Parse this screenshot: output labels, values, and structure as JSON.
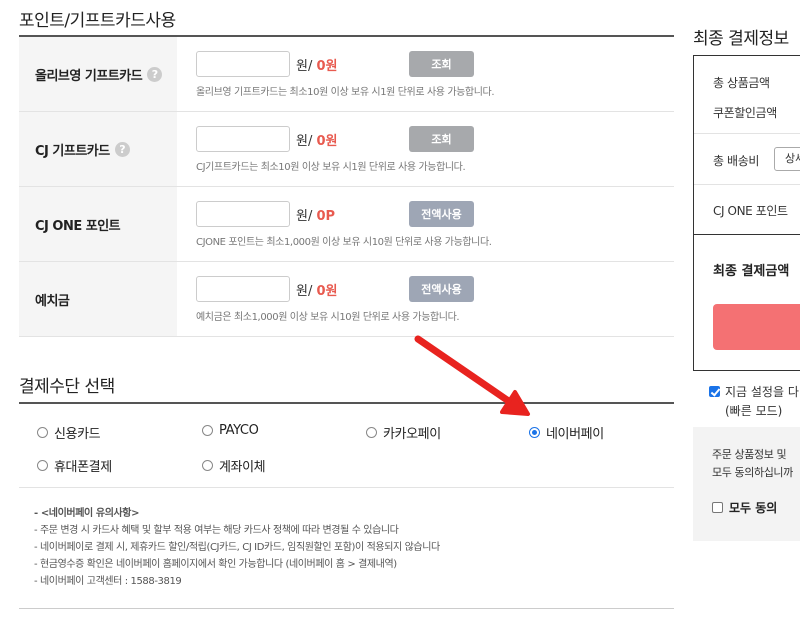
{
  "section_points": {
    "title": "포인트/기프트카드사용",
    "rows": [
      {
        "label": "올리브영 기프트카드",
        "help": "?",
        "unit": "원",
        "value": "0원",
        "button": "조회",
        "note": "올리브영 기프트카드는 최소10원 이상 보유 시1원 단위로 사용 가능합니다."
      },
      {
        "label": "CJ 기프트카드",
        "help": "?",
        "unit": "원",
        "value": "0원",
        "button": "조회",
        "note": "CJ기프트카드는 최소10원 이상 보유 시1원 단위로 사용 가능합니다."
      },
      {
        "label": "CJ ONE 포인트",
        "unit": "원",
        "value": "0P",
        "button": "전액사용",
        "note": "CJONE 포인트는 최소1,000원 이상 보유 시10원 단위로 사용 가능합니다."
      },
      {
        "label": "예치금",
        "unit": "원",
        "value": "0원",
        "button": "전액사용",
        "note": "예치금은 최소1,000원 이상 보유 시10원 단위로 사용 가능합니다."
      }
    ]
  },
  "section_payment": {
    "title": "결제수단 선택",
    "methods": [
      {
        "label": "신용카드",
        "selected": false
      },
      {
        "label": "PAYCO",
        "selected": false
      },
      {
        "label": "카카오페이",
        "selected": false
      },
      {
        "label": "네이버페이",
        "selected": true
      },
      {
        "label": "휴대폰결제",
        "selected": false
      },
      {
        "label": "계좌이체",
        "selected": false
      }
    ],
    "notice_head": "- <네이버페이 유의사항>",
    "notices": [
      "- 주문 변경 시 카드사 혜택 및 할부 적용 여부는 해당 카드사 정책에 따라 변경될 수 있습니다",
      "- 네이버페이로 결제 시, 제휴카드 할인/적립(CJ카드, CJ ID카드, 임직원할인 포함)이 적용되지 않습니다",
      "- 현금영수증 확인은 네이버페이 홈페이지에서 확인 가능합니다 (네이버페이 홈 > 결제내역)",
      "- 네이버페이 고객센터 : 1588-3819"
    ]
  },
  "summary": {
    "title": "최종 결제정보",
    "total_product": "총 상품금액",
    "coupon_discount": "쿠폰할인금액",
    "shipping": "총 배송비",
    "shipping_button": "상세",
    "cjone_point": "CJ ONE 포인트",
    "final_amount": "최종 결제금액",
    "save_setting": "지금 설정을 다",
    "fast_mode": "(빠른 모드)",
    "agree_line1": "주문 상품정보 및",
    "agree_line2": "모두 동의하십니까",
    "agree_all": "모두 동의"
  },
  "colors": {
    "accent_red": "#e85a4f",
    "pay_button": "#f47173",
    "annotation_arrow": "#e8231f",
    "radio_selected": "#1a73e8"
  }
}
